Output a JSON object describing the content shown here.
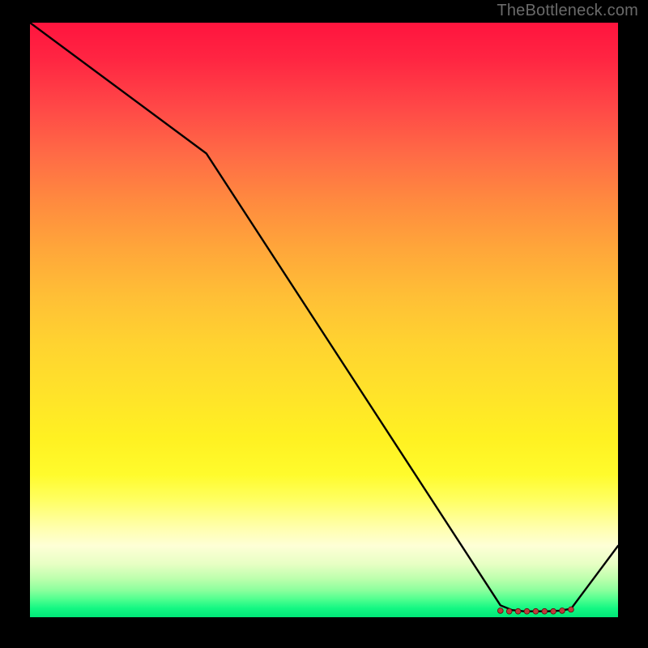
{
  "attribution": "TheBottleneck.com",
  "chart_data": {
    "type": "line",
    "title": "",
    "xlabel": "",
    "ylabel": "",
    "xlim": [
      0,
      100
    ],
    "ylim": [
      0,
      100
    ],
    "series": [
      {
        "name": "curve",
        "x": [
          0,
          30,
          80,
          82,
          84,
          86,
          88,
          90,
          92,
          100
        ],
        "y": [
          100,
          78,
          2,
          1.2,
          1.0,
          1.0,
          1.0,
          1.1,
          1.4,
          12
        ]
      }
    ],
    "markers": {
      "x": [
        80,
        81.5,
        83,
        84.5,
        86,
        87.5,
        89,
        90.5,
        92
      ],
      "y": [
        1.1,
        1.0,
        1.0,
        1.0,
        1.0,
        1.0,
        1.0,
        1.1,
        1.3
      ]
    },
    "background_gradient": {
      "top": "#ff143e",
      "mid": "#ffe22a",
      "bottom": "#00e778"
    }
  }
}
